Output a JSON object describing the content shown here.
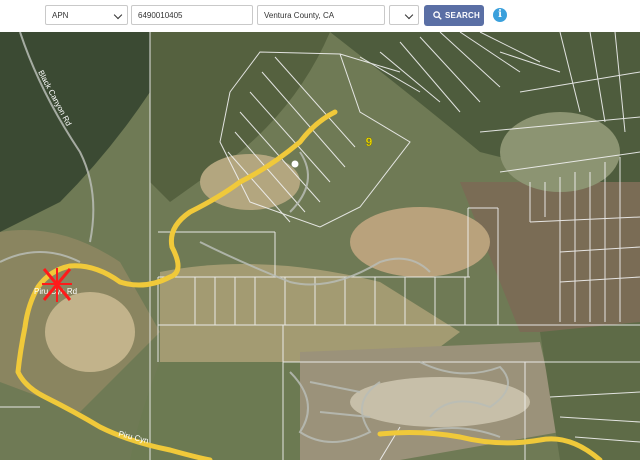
{
  "search": {
    "field_type": "APN",
    "apn_value": "6490010405",
    "county_value": "Ventura County, CA",
    "extra_select_value": "",
    "search_label": "SEARCH",
    "info_icon": "info-icon"
  },
  "map": {
    "type": "satellite",
    "parcel_marker_number": "9",
    "road_label_left": "Black Canyon Rd",
    "road_label_center": "Piru Cyn Rd",
    "road_label_bottom": "Piru Cyn",
    "colors": {
      "road": "#f0c93a",
      "parcel_lines": "#f2f2f2",
      "parcel_marker": "#f5e400",
      "location_marker": "#ff1a1a"
    }
  }
}
